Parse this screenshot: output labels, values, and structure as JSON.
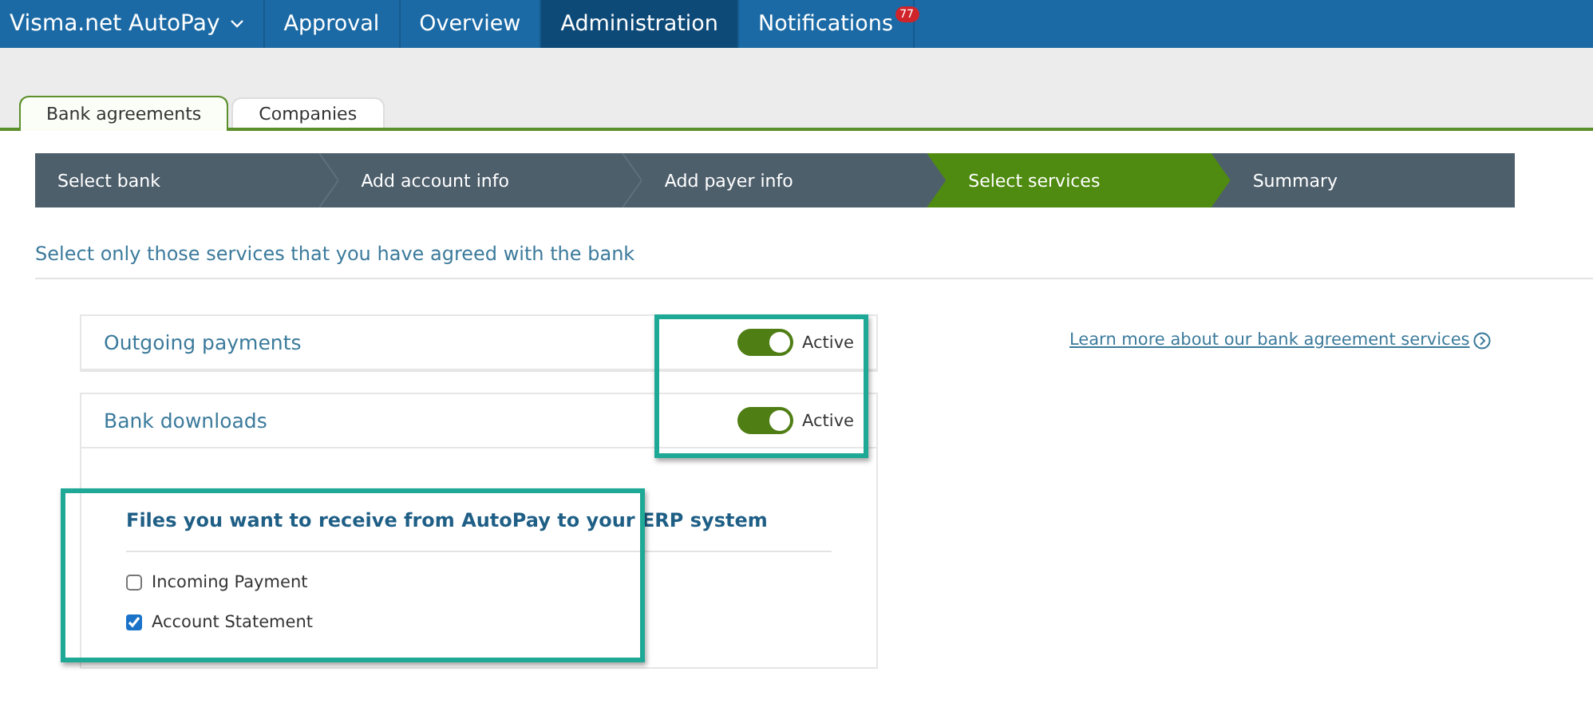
{
  "nav": {
    "brand": "Visma.net AutoPay",
    "items": [
      {
        "label": "Approval",
        "selected": false
      },
      {
        "label": "Overview",
        "selected": false
      },
      {
        "label": "Administration",
        "selected": true
      },
      {
        "label": "Notifications",
        "selected": false,
        "badge": "77"
      }
    ]
  },
  "tabs": [
    {
      "label": "Bank agreements",
      "selected": true
    },
    {
      "label": "Companies",
      "selected": false
    }
  ],
  "steps": [
    {
      "label": "Select bank",
      "selected": false
    },
    {
      "label": "Add account info",
      "selected": false
    },
    {
      "label": "Add payer info",
      "selected": false
    },
    {
      "label": "Select services",
      "selected": true
    },
    {
      "label": "Summary",
      "selected": false
    }
  ],
  "instruction": "Select only those services that you have agreed with the bank",
  "services": [
    {
      "name": "Outgoing payments",
      "on": true,
      "status": "Active"
    },
    {
      "name": "Bank downloads",
      "on": true,
      "status": "Active"
    }
  ],
  "files": {
    "title": "Files you want to receive from AutoPay to your ERP system",
    "options": [
      {
        "label": "Incoming Payment",
        "checked": false
      },
      {
        "label": "Account Statement",
        "checked": true
      }
    ]
  },
  "link": "Learn more about our bank agreement services"
}
